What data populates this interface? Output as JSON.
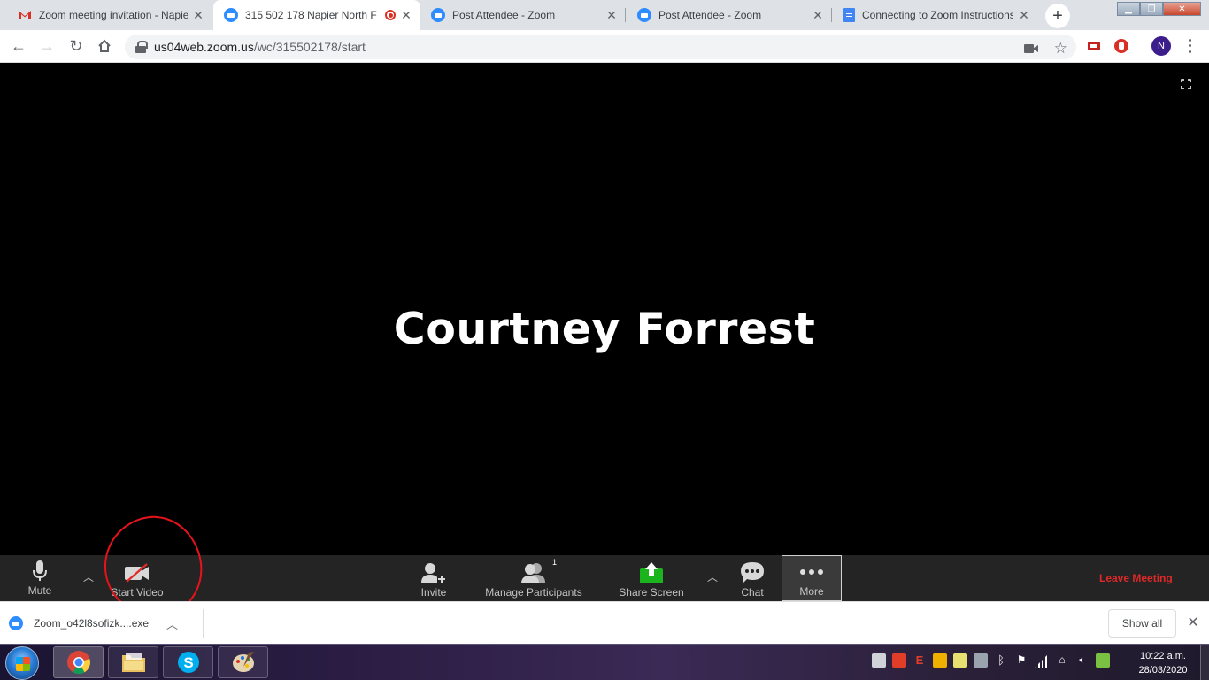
{
  "browser": {
    "tabs": [
      {
        "title": "Zoom meeting invitation - Napier",
        "favicon": "gmail-icon",
        "active": false
      },
      {
        "title": "315 502 178 Napier North F",
        "favicon": "zoom-icon",
        "active": true,
        "recording": true
      },
      {
        "title": "Post Attendee - Zoom",
        "favicon": "zoom-icon",
        "active": false
      },
      {
        "title": "Post Attendee - Zoom",
        "favicon": "zoom-icon",
        "active": false
      },
      {
        "title": "Connecting to Zoom Instructions",
        "favicon": "docs-icon",
        "active": false
      }
    ],
    "url_host": "us04web.zoom.us",
    "url_path": "/wc/315502178/start",
    "profile_initial": "N"
  },
  "meeting": {
    "speaker_name": "Courtney Forrest"
  },
  "controls": {
    "mute_label": "Mute",
    "start_video_label": "Start Video",
    "invite_label": "Invite",
    "manage_participants_label": "Manage Participants",
    "participant_count": "1",
    "share_screen_label": "Share Screen",
    "chat_label": "Chat",
    "more_label": "More",
    "leave_label": "Leave Meeting"
  },
  "downloads": {
    "file_name": "Zoom_o42l8sofizk....exe",
    "show_all_label": "Show all"
  },
  "taskbar": {
    "time": "10:22 a.m.",
    "date": "28/03/2020"
  },
  "colors": {
    "leave": "#e02828",
    "share_screen": "#1cb41c",
    "annotation_circle": "#e8131a",
    "zoom_blue": "#2d8cff"
  }
}
